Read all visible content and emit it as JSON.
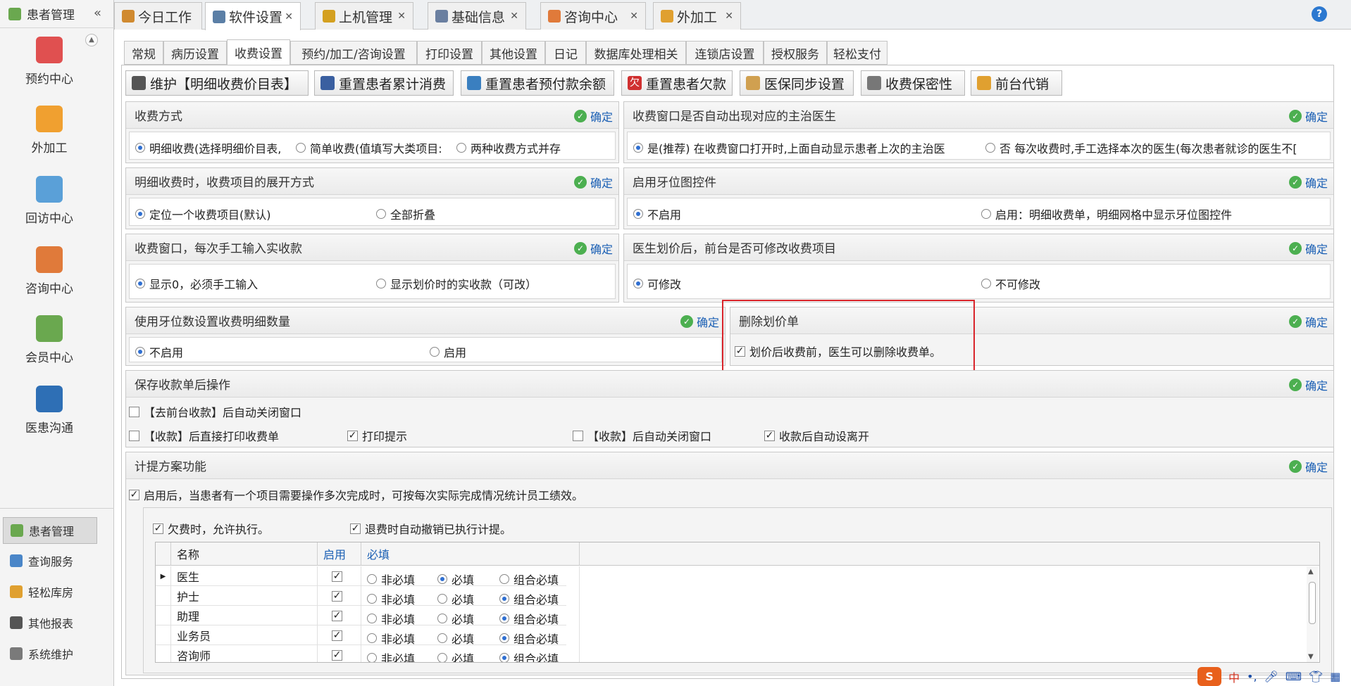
{
  "sidebar": {
    "title": "患者管理",
    "collapse_icon": "«",
    "big_items": [
      {
        "label": "预约中心",
        "icon": "calendar-icon",
        "color": "#e05050"
      },
      {
        "label": "外加工",
        "icon": "cubes-icon",
        "color": "#f0a030"
      },
      {
        "label": "回访中心",
        "icon": "refresh-icon",
        "color": "#5aa0d8"
      },
      {
        "label": "咨询中心",
        "icon": "consult-user-icon",
        "color": "#e07a3a"
      },
      {
        "label": "会员中心",
        "icon": "members-icon",
        "color": "#6aa84f"
      },
      {
        "label": "医患沟通",
        "icon": "video-icon",
        "color": "#2e6fb5"
      }
    ],
    "small_items": [
      {
        "label": "患者管理",
        "icon": "patients-icon",
        "color": "#6aa84f",
        "active": true
      },
      {
        "label": "查询服务",
        "icon": "search-icon",
        "color": "#4a86c8",
        "active": false
      },
      {
        "label": "轻松库房",
        "icon": "warehouse-icon",
        "color": "#e0a030",
        "active": false
      },
      {
        "label": "其他报表",
        "icon": "report-icon",
        "color": "#555555",
        "active": false
      },
      {
        "label": "系统维护",
        "icon": "gear-icon",
        "color": "#7a7a7a",
        "active": false
      }
    ]
  },
  "top_tabs": [
    {
      "label": "今日工作",
      "icon": "work-icon",
      "color": "#d08a30",
      "closable": false,
      "active": false
    },
    {
      "label": "软件设置",
      "icon": "settings-icon",
      "color": "#5b7fa6",
      "closable": true,
      "active": true
    },
    {
      "label": "上机管理",
      "icon": "lock-icon",
      "color": "#d4a020",
      "closable": true,
      "active": false
    },
    {
      "label": "基础信息",
      "icon": "info-icon",
      "color": "#6a7fa0",
      "closable": true,
      "active": false
    },
    {
      "label": "咨询中心",
      "icon": "consult-user-icon",
      "color": "#e07a3a",
      "closable": true,
      "active": false
    },
    {
      "label": "外加工",
      "icon": "cubes-icon",
      "color": "#e0a030",
      "closable": true,
      "active": false
    }
  ],
  "sub_tabs": [
    "常规",
    "病历设置",
    "收费设置",
    "预约/加工/咨询设置",
    "打印设置",
    "其他设置",
    "日记",
    "数据库处理相关",
    "连锁店设置",
    "授权服务",
    "轻松支付"
  ],
  "active_sub_tab": "收费设置",
  "toolbar": [
    {
      "label": "维护【明细收费价目表】",
      "icon": "list-icon",
      "color": "#555555"
    },
    {
      "label": "重置患者累计消费",
      "icon": "tag-icon",
      "color": "#3a5fa0"
    },
    {
      "label": "重置患者预付款余额",
      "icon": "table-icon",
      "color": "#3a7fc0"
    },
    {
      "label": "重置患者欠款",
      "icon": "debt-icon",
      "color": "#d03030",
      "glyph": "欠"
    },
    {
      "label": "医保同步设置",
      "icon": "insurance-icon",
      "color": "#d0a050"
    },
    {
      "label": "收费保密性",
      "icon": "printer-icon",
      "color": "#777777"
    },
    {
      "label": "前台代销",
      "icon": "box-icon",
      "color": "#e0a030"
    }
  ],
  "confirm_label": "确定",
  "groups": {
    "pay_mode": {
      "title": "收费方式",
      "options": [
        "明细收费(选择明细价目表,",
        "简单收费(值填写大类项目:",
        "两种收费方式并存"
      ],
      "selected": 0
    },
    "auto_doctor": {
      "title": "收费窗口是否自动出现对应的主治医生",
      "options": [
        "是(推荐)   在收费窗口打开时,上面自动显示患者上次的主治医",
        "否    每次收费时,手工选择本次的医生(每次患者就诊的医生不["
      ],
      "selected": 0
    },
    "expand_mode": {
      "title": "明细收费时，收费项目的展开方式",
      "options": [
        "定位一个收费项目(默认)",
        "全部折叠"
      ],
      "selected": 0
    },
    "tooth_ctrl": {
      "title": "启用牙位图控件",
      "options": [
        "不启用",
        "启用：明细收费单，明细网格中显示牙位图控件"
      ],
      "selected": 0
    },
    "manual_input": {
      "title": "收费窗口，每次手工输入实收款",
      "options": [
        "显示0，必须手工输入",
        "显示划价时的实收款（可改）"
      ],
      "selected": 0
    },
    "doctor_modify": {
      "title": "医生划价后，前台是否可修改收费项目",
      "options": [
        "可修改",
        "不可修改"
      ],
      "selected": 0
    },
    "tooth_count": {
      "title": "使用牙位数设置收费明细数量",
      "options": [
        "不启用",
        "启用"
      ],
      "selected": 0
    },
    "delete_bill": {
      "title": "删除划价单",
      "checkbox": "划价后收费前，医生可以删除收费单。",
      "checked": true
    },
    "after_save": {
      "title": "保存收款单后操作",
      "items": [
        {
          "label": "【去前台收款】后自动关闭窗口",
          "checked": false
        },
        {
          "label": "【收款】后直接打印收费单",
          "checked": false
        },
        {
          "label": "打印提示",
          "checked": true
        },
        {
          "label": "【收款】后自动关闭窗口",
          "checked": false
        },
        {
          "label": "收款后自动设离开",
          "checked": true
        }
      ]
    },
    "commission": {
      "title": "计提方案功能",
      "enable_label": "启用后，当患者有一个项目需要操作多次完成时，可按每次实际完成情况统计员工绩效。",
      "enable_checked": true,
      "arrears_label": "欠费时，允许执行。",
      "arrears_checked": true,
      "refund_label": "退费时自动撤销已执行计提。",
      "refund_checked": true
    }
  },
  "table": {
    "headers": [
      "名称",
      "启用",
      "必填"
    ],
    "header_colors": [
      "#222222",
      "#1a5fb4",
      "#1a5fb4"
    ],
    "radio_labels": [
      "非必填",
      "必填",
      "组合必填"
    ],
    "rows": [
      {
        "name": "医生",
        "enabled": true,
        "required": 1,
        "current": true
      },
      {
        "name": "护士",
        "enabled": true,
        "required": 2,
        "current": false
      },
      {
        "name": "助理",
        "enabled": true,
        "required": 2,
        "current": false
      },
      {
        "name": "业务员",
        "enabled": true,
        "required": 2,
        "current": false
      },
      {
        "name": "咨询师",
        "enabled": true,
        "required": 2,
        "current": false
      }
    ]
  },
  "ime_bar": {
    "lang": "中",
    "punct": "•,",
    "logo_color": "#e8601c"
  }
}
